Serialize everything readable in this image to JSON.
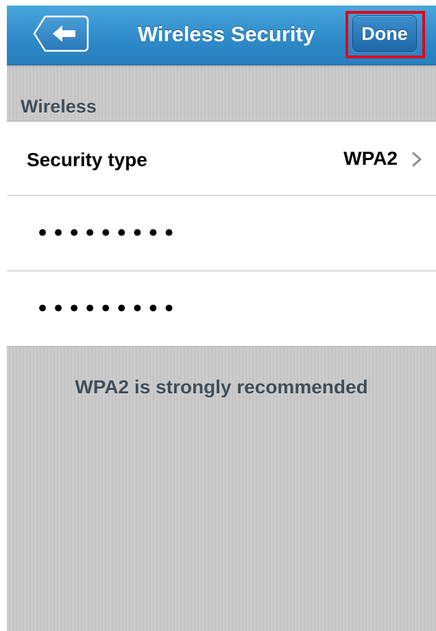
{
  "navbar": {
    "title": "Wireless Security",
    "back_icon": "arrow-left-icon",
    "done_label": "Done"
  },
  "section": {
    "header": "Wireless"
  },
  "security_type": {
    "label": "Security type",
    "value": "WPA2",
    "chevron_icon": "chevron-right-icon"
  },
  "password": {
    "field1_value": "•••••••••",
    "field2_value": "•••••••••"
  },
  "footer": {
    "note": "WPA2 is strongly recommended"
  },
  "colors": {
    "navbar": "#2f8bc9",
    "done_button": "#1f67a6",
    "highlight_outline": "#e0001b",
    "section_text": "#3f4d58",
    "background": "#cbcbcb"
  }
}
